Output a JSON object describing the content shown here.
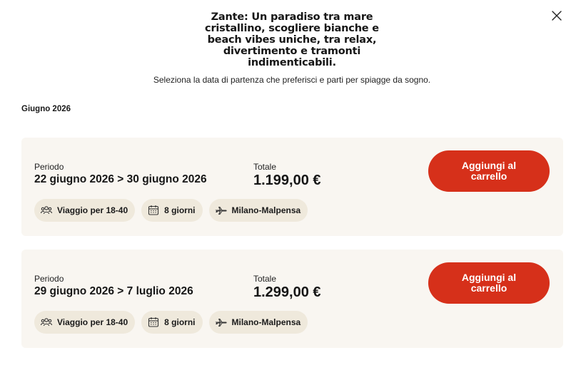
{
  "modal": {
    "title_lines": [
      "Zante: Un paradiso tra mare",
      "cristallino, scogliere bianche e",
      "beach vibes uniche, tra relax,",
      "divertimento e tramonti",
      "indimenticabili."
    ],
    "subtitle": "Seleziona la data di partenza che preferisci e parti per spiagge da sogno.",
    "month": "Giugno 2026",
    "close_icon": "close-icon"
  },
  "offers": [
    {
      "period_label": "Periodo",
      "period": "22 giugno 2026 > 30 giugno 2026",
      "total_label": "Totale",
      "total": "1.199,00 €",
      "button_label": "Aggiungi al carrello",
      "chips": [
        {
          "icon": "group-icon",
          "label": "Viaggio per 18-40"
        },
        {
          "icon": "calendar-icon",
          "label": "8 giorni"
        },
        {
          "icon": "plane-icon",
          "label": "Milano-Malpensa"
        }
      ]
    },
    {
      "period_label": "Periodo",
      "period": "29 giugno 2026 > 7 luglio 2026",
      "total_label": "Totale",
      "total": "1.299,00 €",
      "button_label": "Aggiungi al carrello",
      "chips": [
        {
          "icon": "group-icon",
          "label": "Viaggio per 18-40"
        },
        {
          "icon": "calendar-icon",
          "label": "8 giorni"
        },
        {
          "icon": "plane-icon",
          "label": "Milano-Malpensa"
        }
      ]
    }
  ],
  "colors": {
    "accent": "#d6301a",
    "card_bg": "#f9f6f1",
    "chip_bg": "#efe9dc"
  }
}
